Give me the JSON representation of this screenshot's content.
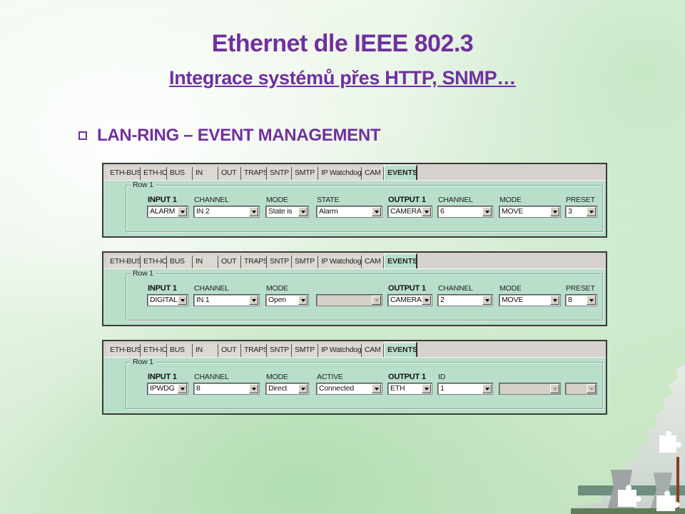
{
  "slide": {
    "title": "Ethernet dle IEEE 802.3",
    "subtitle": "Integrace systémů přes HTTP, SNMP…",
    "bullet": "LAN-RING – EVENT MANAGEMENT",
    "accent_color": "#7030a0"
  },
  "tabs": [
    "ETH-BUS",
    "ETH-IO",
    "BUS",
    "IN",
    "OUT",
    "TRAPS",
    "SNTP",
    "SMTP",
    "IP Watchdog",
    "CAM",
    "EVENTS"
  ],
  "active_tab": "EVENTS",
  "panels": [
    {
      "group_label": "Row 1",
      "fields": [
        {
          "label": "INPUT 1",
          "bold": true,
          "value": "ALARM",
          "disabled": false
        },
        {
          "label": "CHANNEL",
          "bold": false,
          "value": "IN 2",
          "disabled": false
        },
        {
          "label": "MODE",
          "bold": false,
          "value": "State is",
          "disabled": false
        },
        {
          "label": "STATE",
          "bold": false,
          "value": "Alarm",
          "disabled": false
        },
        {
          "label": "OUTPUT 1",
          "bold": true,
          "value": "CAMERA",
          "disabled": false
        },
        {
          "label": "CHANNEL",
          "bold": false,
          "value": "6",
          "disabled": false
        },
        {
          "label": "MODE",
          "bold": false,
          "value": "MOVE",
          "disabled": false
        },
        {
          "label": "PRESET",
          "bold": false,
          "value": "3",
          "disabled": false
        }
      ]
    },
    {
      "group_label": "Row 1",
      "fields": [
        {
          "label": "INPUT 1",
          "bold": true,
          "value": "DIGITAL",
          "disabled": false
        },
        {
          "label": "CHANNEL",
          "bold": false,
          "value": "IN 1",
          "disabled": false
        },
        {
          "label": "MODE",
          "bold": false,
          "value": "Open",
          "disabled": false
        },
        {
          "label": "",
          "bold": false,
          "value": "",
          "disabled": true
        },
        {
          "label": "OUTPUT 1",
          "bold": true,
          "value": "CAMERA",
          "disabled": false
        },
        {
          "label": "CHANNEL",
          "bold": false,
          "value": "2",
          "disabled": false
        },
        {
          "label": "MODE",
          "bold": false,
          "value": "MOVE",
          "disabled": false
        },
        {
          "label": "PRESET",
          "bold": false,
          "value": "8",
          "disabled": false
        }
      ]
    },
    {
      "group_label": "Row 1",
      "fields": [
        {
          "label": "INPUT 1",
          "bold": true,
          "value": "IPWDG",
          "disabled": false
        },
        {
          "label": "CHANNEL",
          "bold": false,
          "value": "8",
          "disabled": false
        },
        {
          "label": "MODE",
          "bold": false,
          "value": "Direct",
          "disabled": false
        },
        {
          "label": "ACTIVE",
          "bold": false,
          "value": "Connected",
          "disabled": false
        },
        {
          "label": "OUTPUT 1",
          "bold": true,
          "value": "ETH",
          "disabled": false
        },
        {
          "label": "ID",
          "bold": false,
          "value": "1",
          "disabled": false
        },
        {
          "label": "",
          "bold": false,
          "value": "",
          "disabled": true
        },
        {
          "label": "",
          "bold": false,
          "value": "",
          "disabled": true
        }
      ]
    }
  ]
}
